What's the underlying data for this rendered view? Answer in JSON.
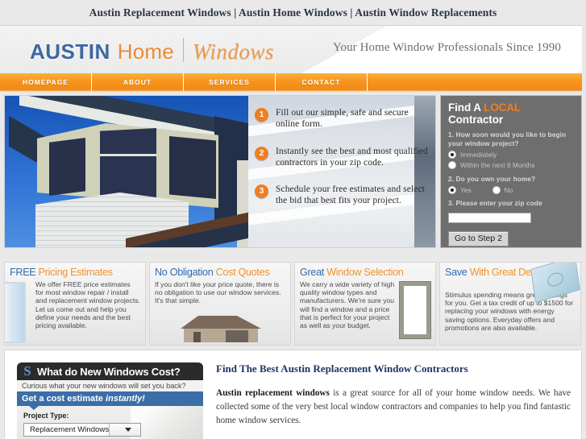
{
  "topbar": {
    "keywords": "Austin Replacement Windows | Austin Home Windows | Austin Window Replacements"
  },
  "header": {
    "logo_austin": "AUSTIN",
    "logo_home": "Home",
    "logo_windows": "Windows",
    "tagline": "Your Home Window Professionals Since 1990"
  },
  "nav": {
    "items": [
      {
        "label": "HOMEPAGE"
      },
      {
        "label": "ABOUT"
      },
      {
        "label": "SERVICES"
      },
      {
        "label": "CONTACT"
      }
    ]
  },
  "hero": {
    "steps": [
      {
        "num": "1",
        "text": "Fill out our simple, safe and  secure online form."
      },
      {
        "num": "2",
        "text": "Instantly see the best and most qualified contractors in your zip code."
      },
      {
        "num": "3",
        "text": "Schedule  your free estimates and  select  the bid that best fits your project."
      }
    ]
  },
  "sideform": {
    "title_a": "Find A ",
    "title_hl": "LOCAL",
    "title_b": " Contractor",
    "q1": "1. How soon would you like to begin your window project?",
    "q1_options": [
      {
        "label": "Immediately",
        "selected": true
      },
      {
        "label": "Within the next 6 Months",
        "selected": false
      }
    ],
    "q2": "2. Do you own your home?",
    "q2_options": [
      {
        "label": "Yes",
        "selected": true
      },
      {
        "label": "No",
        "selected": false
      }
    ],
    "q3": "3. Please enter your zip code",
    "zip_value": "",
    "zip_placeholder": "",
    "submit_label": "Go to Step 2"
  },
  "features": [
    {
      "title_a": "FREE",
      "title_b": " Pricing Estimates",
      "body": "We offer FREE price estimates for most window repair / install and replacement window projects. Let us come out and help you define your needs and the best pricing available.",
      "icon": "window-icon"
    },
    {
      "title_a": "No Obligation",
      "title_b": " Cost Quotes",
      "body": "If you don't like your price quote, there is no obligation to use our window services. It's that simple.",
      "icon": "house-icon"
    },
    {
      "title_a": "Great",
      "title_b": " Window Selection",
      "body": "We carry a wide variety of high quality window types and manufacturers. We're sure you will find a window and a price that is perfect for your project as well as your budget.",
      "icon": "window-frame-icon"
    },
    {
      "title_a": "Save",
      "title_b": " With Great Deals",
      "body": "Stimulus spending means great savings for you. Get a tax credit of up to $1500 for replacing your windows with energy saving options. Everyday offers and promotions are also available.",
      "icon": "money-icon"
    }
  ],
  "calculator": {
    "logo": "S",
    "title": "What do New Windows Cost?",
    "subtitle": "Curious what your new windows will set you back?",
    "bar_text": "Get a cost estimate ",
    "bar_em": "instantly!",
    "project_label": "Project Type:",
    "project_value": "Replacement Windows"
  },
  "article": {
    "heading": "Find The Best Austin Replacement Window Contractors",
    "lead_bold": "Austin replacement windows",
    "lead_rest": " is a great source for all of your home window needs. We have collected some of the very best local window contractors and companies to help you find fantastic home window services."
  },
  "colors": {
    "orange": "#f7941e",
    "blue": "#2e6cb0",
    "dark_navy": "#1c3566",
    "sidebar_grey": "#6e6e6e",
    "accent_orange": "#f07e20",
    "calc_blue": "#3b6ea8"
  }
}
